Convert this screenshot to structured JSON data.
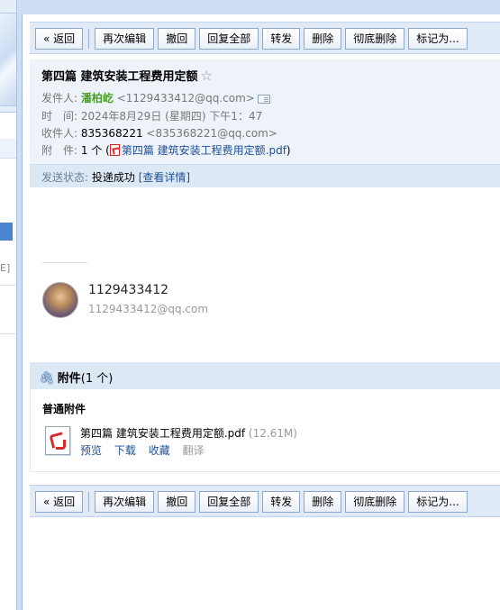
{
  "toolbar": {
    "back": "« 返回",
    "reedit": "再次编辑",
    "recall": "撤回",
    "reply_all": "回复全部",
    "forward": "转发",
    "delete": "删除",
    "delete_permanently": "彻底删除",
    "mark_as": "标记为..."
  },
  "email": {
    "subject": "第四篇 建筑安装工程费用定额",
    "star_icon": "star-icon",
    "from_label": "发件人:",
    "from_name": "潘柏屹",
    "from_email": "<1129433412@qq.com>",
    "time_label": "时　间:",
    "time_value": "2024年8月29日 (星期四) 下午1：47",
    "to_label": "收件人:",
    "to_name": "835368221",
    "to_email": "<835368221@qq.com>",
    "attach_label": "附　件:",
    "attach_count_prefix": "1 个 (",
    "attach_file": "第四篇 建筑安装工程费用定额.pdf",
    "attach_count_suffix": ")",
    "status_label": "发送状态:",
    "status_value": "投递成功",
    "status_link": "[查看详情]"
  },
  "signature": {
    "name": "1129433412",
    "email": "1129433412@qq.com"
  },
  "attachments": {
    "header_title": "附件",
    "header_count": "(1 个)",
    "kind": "普通附件",
    "file_name": "第四篇 建筑安装工程费用定额.pdf",
    "file_size": "(12.61M)",
    "actions": {
      "preview": "预览",
      "download": "下载",
      "save": "收藏",
      "translate": "翻译"
    }
  },
  "sidebar": {
    "glyph": "E]"
  },
  "colors": {
    "accent": "#1f4f97",
    "sender_green": "#4b9e28",
    "header_bg": "#eef3fa",
    "toolbar_bg": "#e1ebf7"
  }
}
